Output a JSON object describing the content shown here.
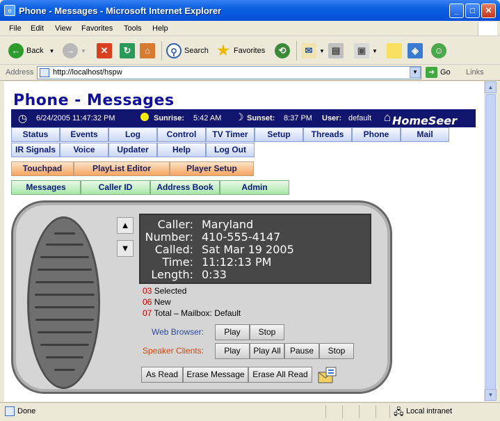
{
  "window": {
    "title": "Phone - Messages - Microsoft Internet Explorer"
  },
  "menu": [
    "File",
    "Edit",
    "View",
    "Favorites",
    "Tools",
    "Help"
  ],
  "toolbar": {
    "back": "Back",
    "search": "Search",
    "favorites": "Favorites"
  },
  "address": {
    "label": "Address",
    "url": "http://localhost/hspw",
    "go": "Go",
    "links": "Links"
  },
  "status": {
    "text": "Done",
    "zone": "Local intranet"
  },
  "page": {
    "title": "Phone - Messages",
    "info": {
      "datetime": "6/24/2005 11:47:32 PM",
      "sunrise_label": "Sunrise:",
      "sunrise": "5:42 AM",
      "sunset_label": "Sunset:",
      "sunset": "8:37 PM",
      "user_label": "User:",
      "user": "default",
      "logo": "HomeSeer"
    },
    "nav_row1": [
      "Status",
      "Events",
      "Log",
      "Control",
      "TV Timer",
      "Setup",
      "Threads",
      "Phone",
      "Mail"
    ],
    "nav_row2": [
      "IR Signals",
      "Voice",
      "Updater",
      "Help",
      "Log Out"
    ],
    "nav_row3": [
      "Touchpad",
      "PlayList Editor",
      "Player Setup"
    ],
    "nav_row4": [
      "Messages",
      "Caller ID",
      "Address Book",
      "Admin"
    ],
    "display": {
      "caller_label": "Caller:",
      "caller": "Maryland",
      "number_label": "Number:",
      "number": "410-555-4147",
      "called_label": "Called:",
      "called": "Sat Mar 19 2005",
      "time_label": "Time:",
      "time": "11:12:13 PM",
      "length_label": "Length:",
      "length": "0:33"
    },
    "counts": {
      "selected_n": "03",
      "selected_label": "Selected",
      "new_n": "06",
      "new_label": "New",
      "total_n": "07",
      "total_label": "Total – Mailbox: Default"
    },
    "web_browser": {
      "label": "Web Browser:",
      "play": "Play",
      "stop": "Stop"
    },
    "speaker_clients": {
      "label": "Speaker Clients:",
      "play": "Play",
      "play_all": "Play All",
      "pause": "Pause",
      "stop": "Stop"
    },
    "actions": {
      "as_read": "As Read",
      "erase_message": "Erase Message",
      "erase_all_read": "Erase All Read"
    },
    "arrows": {
      "up": "▲",
      "down": "▼"
    }
  },
  "colors": {
    "title_blue": "#10109a",
    "infobar": "#11156d",
    "count_red": "#cc0000",
    "web_label": "#2a4aa0",
    "speaker_label": "#d04a10"
  }
}
